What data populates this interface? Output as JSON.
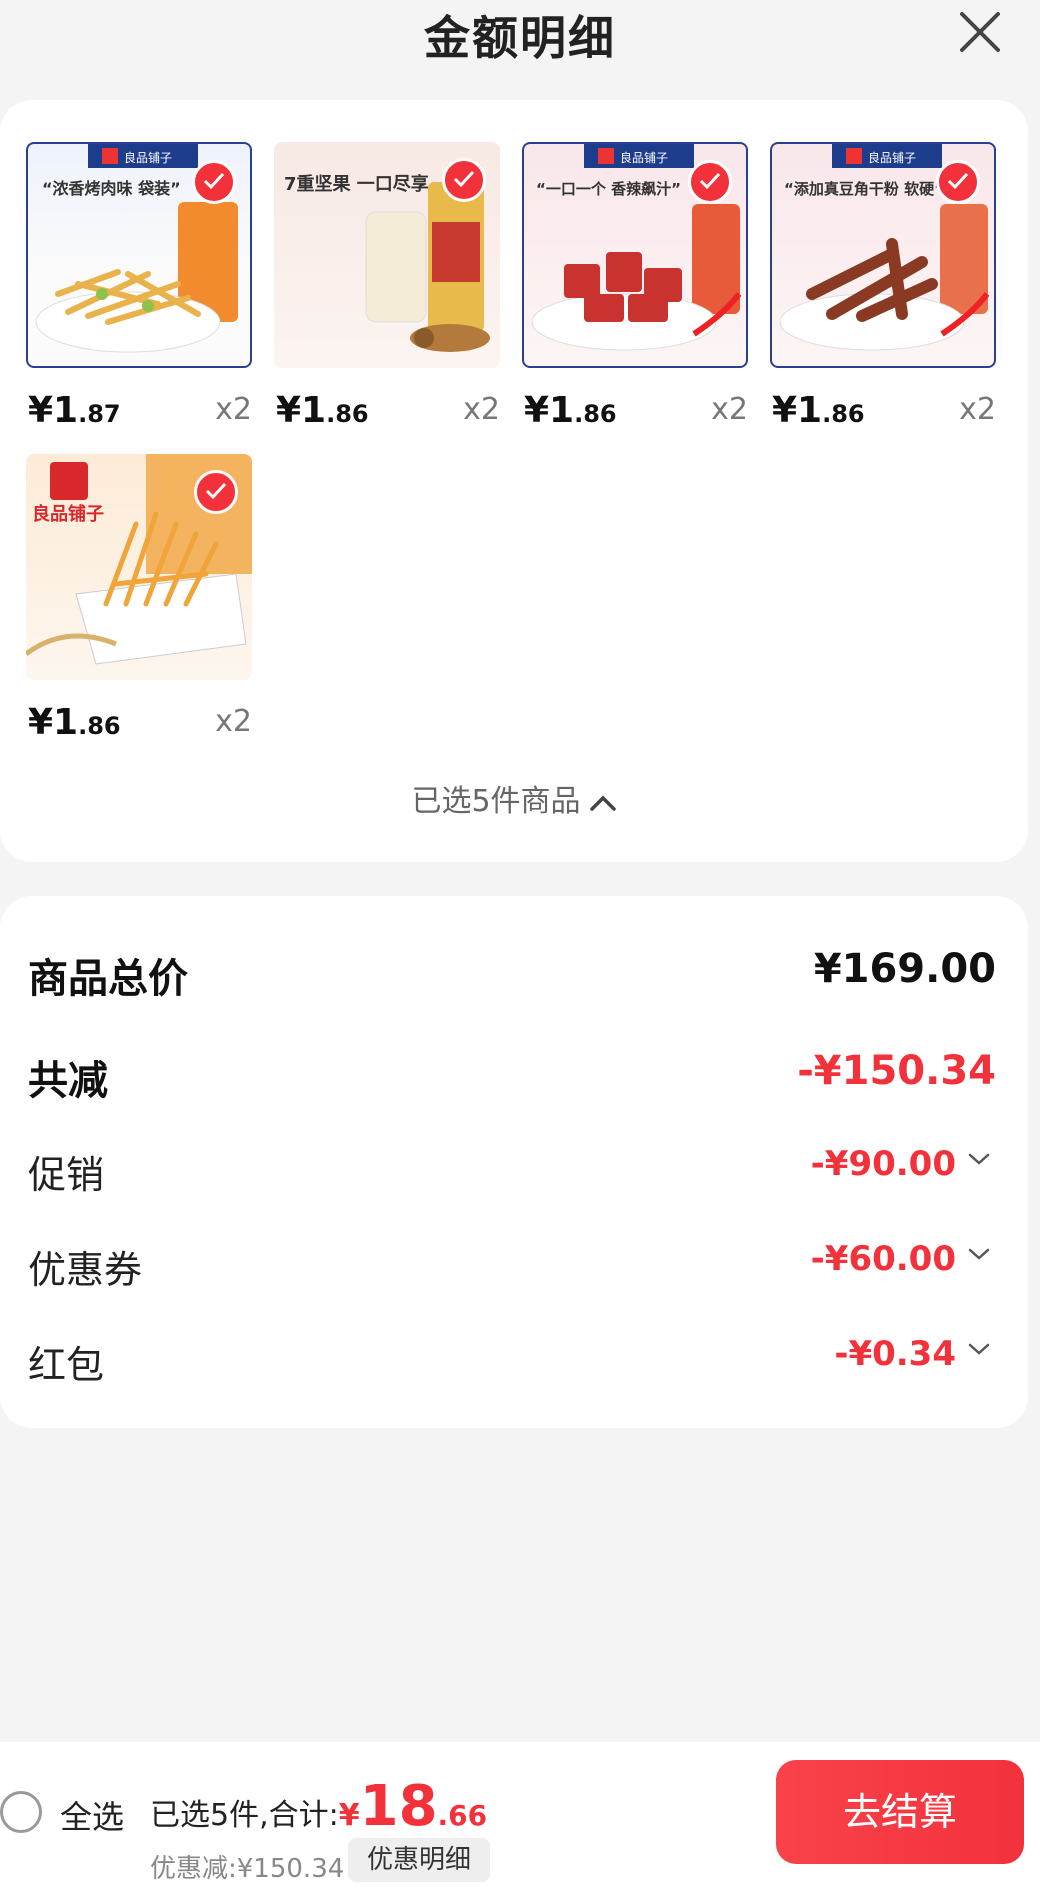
{
  "header": {
    "title": "金额明细",
    "close_icon": "close-icon"
  },
  "products": [
    {
      "price_int": "¥1",
      "price_dec": ".87",
      "qty": "x2",
      "image": "snack-fries-bag",
      "banner": "“浓香烤肉味 袋装”",
      "brand": "良品铺子"
    },
    {
      "price_int": "¥1",
      "price_dec": ".86",
      "qty": "x2",
      "image": "nut-milk-drink",
      "banner": "7重坚果 一口尽享",
      "brand": ""
    },
    {
      "price_int": "¥1",
      "price_dec": ".86",
      "qty": "x2",
      "image": "spicy-strips-plate",
      "banner": "“一口一个 香辣飙汁”",
      "brand": "良品铺子"
    },
    {
      "price_int": "¥1",
      "price_dec": ".86",
      "qty": "x2",
      "image": "tofu-sticks-plate",
      "banner": "“添加真豆角干粉 软硬”",
      "brand": "良品铺子"
    },
    {
      "price_int": "¥1",
      "price_dec": ".86",
      "qty": "x2",
      "image": "potato-sticks-bowl",
      "banner": "",
      "brand": "良品铺子"
    }
  ],
  "selected_toggle": "已选5件商品",
  "summary": {
    "total_label": "商品总价",
    "total_value": "¥169.00",
    "reduce_label": "共减",
    "reduce_value": "-¥150.34",
    "items": [
      {
        "label": "促销",
        "value": "-¥90.00"
      },
      {
        "label": "优惠券",
        "value": "-¥60.00"
      },
      {
        "label": "红包",
        "value": "-¥0.34"
      }
    ]
  },
  "bottom": {
    "select_all": "全选",
    "total_prefix": "已选5件,合计:",
    "currency": "¥",
    "total_int": "18",
    "total_dec": ".66",
    "discount": "优惠减:¥150.34",
    "detail_button": "优惠明细",
    "checkout": "去结算"
  },
  "colors": {
    "accent": "#f2313b",
    "background": "#f4f4f4"
  }
}
